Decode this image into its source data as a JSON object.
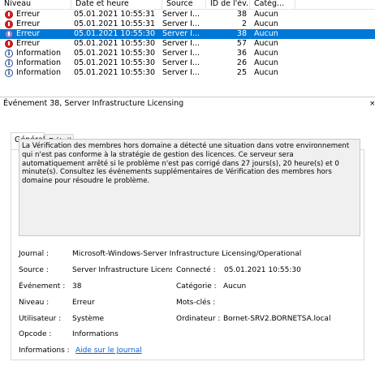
{
  "columns": [
    "Niveau",
    "Date et heure",
    "Source",
    "ID de l'év...",
    "Catég..."
  ],
  "rows": [
    {
      "level": "Erreur",
      "icon": "error-icon",
      "date": "05.01.2021 10:55:31",
      "source": "Server I...",
      "id": "38",
      "task": "Aucun",
      "selected": false
    },
    {
      "level": "Erreur",
      "icon": "error-icon",
      "date": "05.01.2021 10:55:31",
      "source": "Server I...",
      "id": "2",
      "task": "Aucun",
      "selected": false
    },
    {
      "level": "Erreur",
      "icon": "error-icon",
      "date": "05.01.2021 10:55:30",
      "source": "Server I...",
      "id": "38",
      "task": "Aucun",
      "selected": true
    },
    {
      "level": "Erreur",
      "icon": "error-icon",
      "date": "05.01.2021 10:55:30",
      "source": "Server I...",
      "id": "57",
      "task": "Aucun",
      "selected": false
    },
    {
      "level": "Information",
      "icon": "info-icon",
      "date": "05.01.2021 10:55:30",
      "source": "Server I...",
      "id": "36",
      "task": "Aucun",
      "selected": false
    },
    {
      "level": "Information",
      "icon": "info-icon",
      "date": "05.01.2021 10:55:30",
      "source": "Server I...",
      "id": "26",
      "task": "Aucun",
      "selected": false
    },
    {
      "level": "Information",
      "icon": "info-icon",
      "date": "05.01.2021 10:55:30",
      "source": "Server I...",
      "id": "25",
      "task": "Aucun",
      "selected": false
    }
  ],
  "detail": {
    "title": "Événement 38, Server Infrastructure Licensing",
    "close": "×",
    "tabs": [
      "Général",
      "Détails"
    ],
    "description": "La Vérification des membres hors domaine a détecté une situation dans votre environnement qui n'est pas conforme à la stratégie de gestion des licences. Ce serveur sera automatiquement arrêté si le problème n'est pas corrigé dans 27 jours(s), 20 heure(s) et 0 minute(s). Consultez les événements supplémentaires de Vérification des membres hors domaine pour résoudre le problème.",
    "journal_label": "Journal :",
    "journal_value": "Microsoft-Windows-Server Infrastructure Licensing/Operational",
    "source_label": "Source :",
    "source_value": "Server Infrastructure Licensir",
    "logged_label": "Connecté :",
    "logged_value": "05.01.2021 10:55:30",
    "event_label": "Événement :",
    "event_value": "38",
    "category_label": "Catégorie :",
    "category_value": "Aucun",
    "level_label": "Niveau :",
    "level_value": "Erreur",
    "keywords_label": "Mots-clés :",
    "keywords_value": "",
    "user_label": "Utilisateur :",
    "user_value": "Système",
    "computer_label": "Ordinateur :",
    "computer_value": "Bornet-SRV2.BORNETSA.local",
    "opcode_label": "Opcode :",
    "opcode_value": "Informations",
    "info_label": "Informations :",
    "info_link": "Aide sur le Journal"
  },
  "colors": {
    "selection": "#0078d7",
    "link": "#0b5fd6",
    "error": "#d72222"
  }
}
